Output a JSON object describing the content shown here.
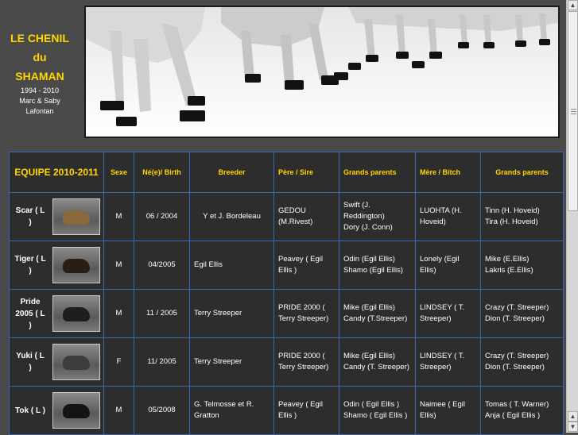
{
  "logo": {
    "line1": "LE CHENIL",
    "line2": "du",
    "line3": "SHAMAN",
    "years": "1994 - 2010",
    "owners1": "Marc & Saby",
    "owners2": "Lafontan"
  },
  "table": {
    "headers": {
      "team": "EQUIPE 2010-2011",
      "sexe": "Sexe",
      "birth": "Né(e)/ Birth",
      "breeder": "Breeder",
      "sire": "Père / Sire",
      "gp1": "Grands parents",
      "dam": "Mère / Bitch",
      "gp2": "Grands parents"
    },
    "rows": [
      {
        "name": "Scar ( L )",
        "sexe": "M",
        "birth": "06 / 2004",
        "breeder": "Y et J. Bordeleau",
        "sire": "GEDOU (M.Rivest)",
        "sire_gp1": "Swift (J. Reddington)",
        "sire_gp2": "Dory (J. Conn)",
        "dam": "LUOHTA (H. Hoveid)",
        "dam_gp1": "Tinn (H. Hoveid)",
        "dam_gp2": "Tira (H. Hoveid)",
        "photo_color": "#8a6a3a"
      },
      {
        "name": "Tiger ( L )",
        "sexe": "M",
        "birth": "04/2005",
        "breeder": "Egil Ellis",
        "sire": "Peavey ( Egil Ellis )",
        "sire_gp1": "Odin (Egil Ellis)",
        "sire_gp2": "Shamo (Egil Ellis)",
        "dam": "Lonely (Egil Ellis)",
        "dam_gp1": "Mike (E.Ellis)",
        "dam_gp2": "Lakris (E.Ellis)",
        "photo_color": "#2a1e14"
      },
      {
        "name": "Pride 2005 ( L )",
        "sexe": "M",
        "birth": "11 / 2005",
        "breeder": "Terry Streeper",
        "sire": "PRIDE 2000 ( Terry Streeper)",
        "sire_gp1": "Mike (Egil Ellis)",
        "sire_gp2": "Candy (T.Streeper)",
        "dam": "LINDSEY ( T. Streeper)",
        "dam_gp1": "Crazy (T. Streeper)",
        "dam_gp2": "Dion (T. Streeper)",
        "photo_color": "#1e1e1e"
      },
      {
        "name": "Yuki ( L )",
        "sexe": "F",
        "birth": "11/ 2005",
        "breeder": "Terry Streeper",
        "sire": "PRIDE 2000 ( Terry Streeper)",
        "sire_gp1": "Mike (Egil Ellis)",
        "sire_gp2": "Candy (T. Streeper)",
        "dam": "LINDSEY ( T. Streeper)",
        "dam_gp1": "Crazy (T. Streeper)",
        "dam_gp2": "Dion (T. Streeper)",
        "photo_color": "#3c3c3c"
      },
      {
        "name": "Tok ( L )",
        "sexe": "M",
        "birth": "05/2008",
        "breeder": "G. Telmosse et R. Gratton",
        "sire": "Peavey ( Egil Ellis )",
        "sire_gp1": "Odin ( Egil Ellis )",
        "sire_gp2": "Shamo ( Egil Ellis )",
        "dam": "Naimee ( Egil Ellis)",
        "dam_gp1": "Tomas ( T. Warner)",
        "dam_gp2": "Anja ( Egil Ellis )",
        "photo_color": "#141414"
      }
    ]
  }
}
